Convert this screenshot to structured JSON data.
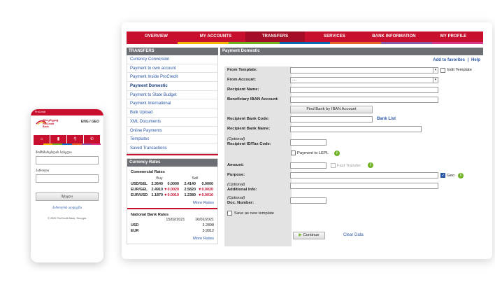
{
  "colors": {
    "brand_red": "#c8102e",
    "link_blue": "#2a56a6",
    "stripe": [
      "#c8102e",
      "#f2b705",
      "#6fb325",
      "#0a6ab4",
      "#e5672a",
      "#8b5aa6",
      "#d43a8b"
    ]
  },
  "nav": {
    "tabs": [
      "OVERVIEW",
      "MY ACCOUNTS",
      "TRANSFERS",
      "SERVICES",
      "BANK INFORMATION",
      "MY PROFILE"
    ],
    "active_index": 2
  },
  "sidebar": {
    "title": "TRANSFERS",
    "items": [
      "Currency Conversion",
      "Payment to own account",
      "Payment Inside ProCredit",
      "Payment Domestic",
      "Payment to State Budget",
      "Payment International",
      "Bulk Upload",
      "XML Documents",
      "Online Payments",
      "Templates",
      "Saved Transactions"
    ],
    "active_index": 3
  },
  "rates": {
    "title": "Currency Rates",
    "commercial": {
      "title": "Commercial Rates",
      "buy_label": "Buy",
      "sell_label": "Sell",
      "rows": [
        {
          "pair": "USD/GEL",
          "buy": "2.3640",
          "buy_change": "0.0000",
          "sell": "2.4140",
          "sell_change": "0.0000",
          "down": false
        },
        {
          "pair": "EUR/GEL",
          "buy": "2.4910",
          "buy_change": "▼0.0020",
          "sell": "2.5820",
          "sell_change": "▼0.0020",
          "down": true
        },
        {
          "pair": "EUR/USD",
          "buy": "1.1870",
          "buy_change": "▼0.0010",
          "sell": "1.2380",
          "sell_change": "▼0.0010",
          "down": true
        }
      ],
      "more": "More Rates"
    },
    "national": {
      "title": "National Bank Rates",
      "dates": [
        "15/02/2021",
        "16/02/2021"
      ],
      "rows": [
        {
          "cur": "USD",
          "v1": "",
          "v2": "3.2898"
        },
        {
          "cur": "EUR",
          "v1": "",
          "v2": "3.9912"
        }
      ],
      "more": "More Rates"
    }
  },
  "form": {
    "title": "Payment Domestic",
    "add_favorites": "Add to favorites",
    "separator": "|",
    "help": "Help",
    "from_template_label": "From Template:",
    "edit_template_label": "Edit Template",
    "from_account_label": "From Account:",
    "from_account_value": "....",
    "recipient_name_label": "Recipient Name:",
    "iban_label": "Beneficiary IBAN Account:",
    "find_bank_button": "Find Bank by IBAN Account",
    "bank_code_label": "Recipient Bank Code:",
    "bank_list_link": "Bank List",
    "bank_name_label": "Recipient Bank Name:",
    "optional": "(Optional)",
    "tax_code_label": "Recipient ID/Tax Code:",
    "payment_lepl_label": "Payment to LEPL",
    "amount_label": "Amount:",
    "fast_transfer_label": "Fast Transfer",
    "purpose_label": "Purpose:",
    "geo_label": "Geo",
    "additional_info_label": "Additional Info:",
    "doc_number_label": "Doc. Number:",
    "save_template_label": "Save as new template",
    "continue_button": "Continue",
    "clear_data_link": "Clear Data"
  },
  "mobile": {
    "top_bar": "ProCredit",
    "logo_line1": "პროკრედიტ",
    "logo_line2": "ProCredit Bank",
    "lang": "ENG / GEO",
    "icons": [
      "home-icon",
      "chart-icon",
      "location-icon",
      "phone-icon"
    ],
    "username_label": "მომხმარებლის სახელი",
    "password_label": "პაროლი",
    "login_button": "შესვლა",
    "forgot_link": "პაროლის აღდგენა",
    "footer": "© 2020 ProCredit Bank, Georgia."
  }
}
